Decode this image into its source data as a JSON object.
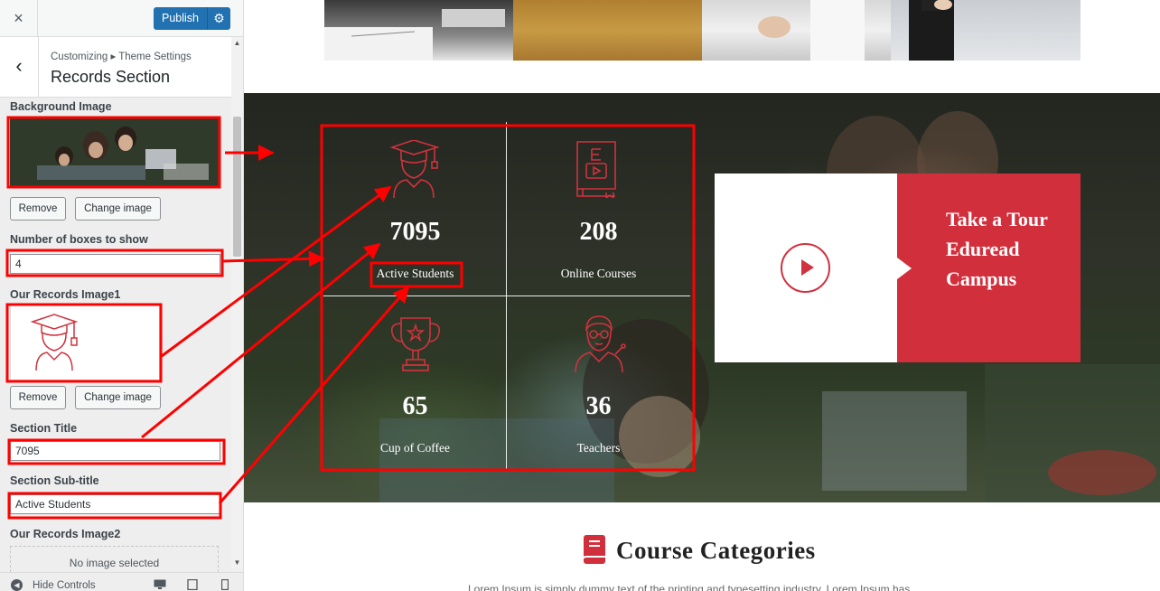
{
  "topbar": {
    "close_icon": "×",
    "publish_label": "Publish",
    "gear_icon": "⚙"
  },
  "section": {
    "back_icon": "‹",
    "breadcrumb": "Customizing ▸ Theme Settings",
    "title": "Records Section"
  },
  "controls": {
    "bg_image_label": "Background Image",
    "remove_label": "Remove",
    "change_label": "Change image",
    "boxes_label": "Number of boxes to show",
    "boxes_value": "4",
    "rec_image1_label": "Our Records Image1",
    "section_title_label": "Section Title",
    "section_title_value": "7095",
    "subtitle_label": "Section Sub-title",
    "subtitle_value": "Active Students",
    "rec_image2_label": "Our Records Image2",
    "no_image_text": "No image selected"
  },
  "footer": {
    "hide_controls": "Hide Controls",
    "icons": [
      "desktop-icon",
      "tablet-icon",
      "mobile-icon"
    ]
  },
  "records": [
    {
      "number": "7095",
      "label": "Active Students",
      "icon": "graduate-icon"
    },
    {
      "number": "208",
      "label": "Online Courses",
      "icon": "book-video-icon"
    },
    {
      "number": "65",
      "label": "Cup of Coffee",
      "icon": "trophy-icon"
    },
    {
      "number": "36",
      "label": "Teachers",
      "icon": "teacher-icon"
    }
  ],
  "tour": {
    "text": "Take a Tour Eduread Campus"
  },
  "course": {
    "title": "Course Categories",
    "description": "Lorem Ipsum is simply dummy text of the printing and typesetting industry. Lorem Ipsum has"
  },
  "colors": {
    "accent": "#d22f3c",
    "annotation": "#ff0000",
    "publish": "#2271b1"
  }
}
